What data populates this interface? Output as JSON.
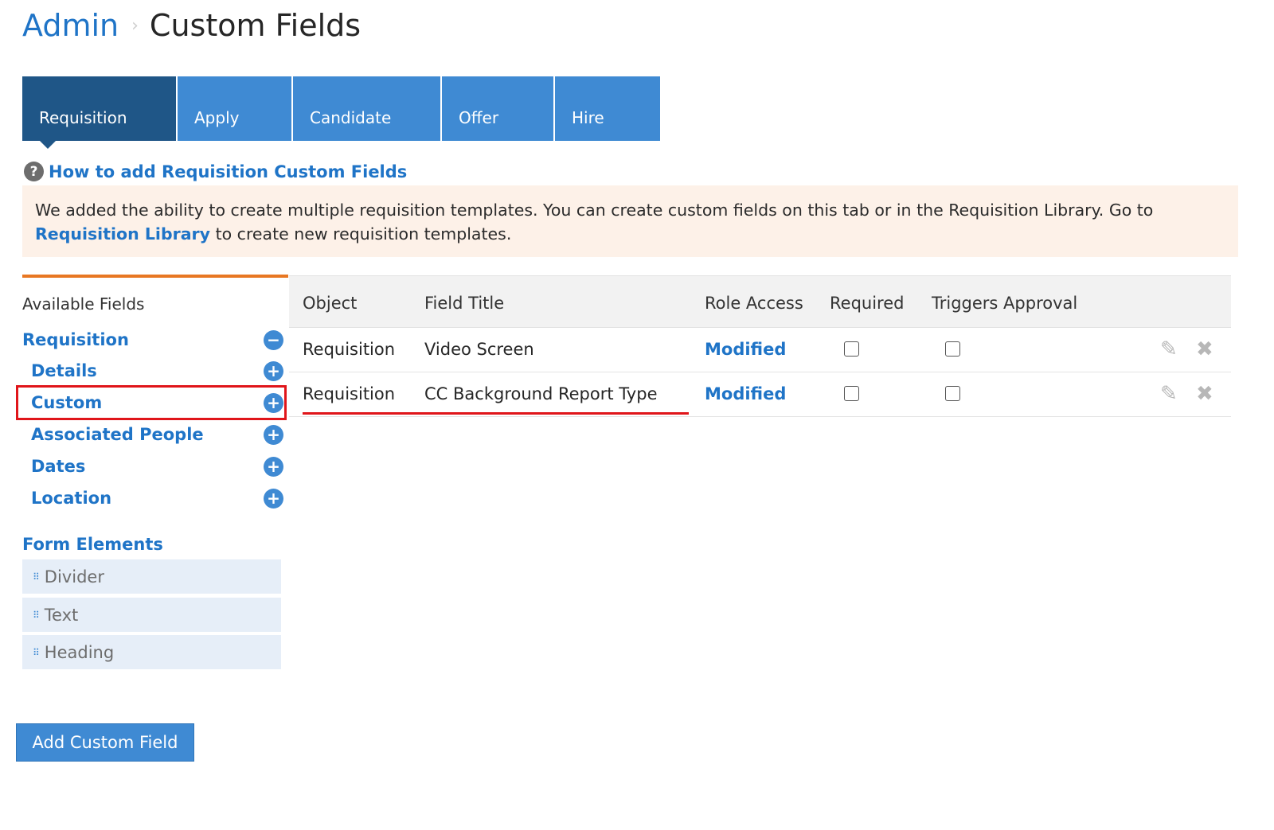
{
  "breadcrumb": {
    "parent": "Admin",
    "separator": "›",
    "current": "Custom Fields"
  },
  "tabs": [
    {
      "label": "Requisition",
      "active": true
    },
    {
      "label": "Apply",
      "active": false
    },
    {
      "label": "Candidate",
      "active": false
    },
    {
      "label": "Offer",
      "active": false
    },
    {
      "label": "Hire",
      "active": false
    }
  ],
  "help": {
    "icon": "question-circle-icon",
    "link_text": "How to add Requisition Custom Fields"
  },
  "notice": {
    "text_before": "We added the ability to create multiple requisition templates. You can create custom fields on this tab or in the Requisition Library. Go to",
    "link_text": "Requisition Library",
    "text_after": "to create new requisition templates."
  },
  "sidebar": {
    "heading": "Available Fields",
    "group": {
      "label": "Requisition",
      "icon": "minus-circle-icon"
    },
    "items": [
      {
        "label": "Details",
        "icon": "plus-circle-icon"
      },
      {
        "label": "Custom",
        "icon": "plus-circle-icon"
      },
      {
        "label": "Associated People",
        "icon": "plus-circle-icon"
      },
      {
        "label": "Dates",
        "icon": "plus-circle-icon"
      },
      {
        "label": "Location",
        "icon": "plus-circle-icon"
      }
    ],
    "form_elements_heading": "Form Elements",
    "form_elements": [
      {
        "label": "Divider",
        "icon": "drag-handle-icon"
      },
      {
        "label": "Text",
        "icon": "drag-handle-icon"
      },
      {
        "label": "Heading",
        "icon": "drag-handle-icon"
      }
    ]
  },
  "table": {
    "headers": [
      "Object",
      "Field Title",
      "Role Access",
      "Required",
      "Triggers Approval"
    ],
    "rows": [
      {
        "object": "Requisition",
        "field_title": "Video Screen",
        "role_access": "Modified",
        "required": false,
        "triggers_approval": false
      },
      {
        "object": "Requisition",
        "field_title": "CC Background Report Type",
        "role_access": "Modified",
        "required": false,
        "triggers_approval": false
      }
    ]
  },
  "add_button": "Add Custom Field",
  "colors": {
    "link": "#1f74c7",
    "tab": "#3f8ad3",
    "tab_active": "#1f5687",
    "accent_orange": "#e87722",
    "annotation_red": "#e0151a",
    "notice_bg": "#fdf1e8"
  }
}
